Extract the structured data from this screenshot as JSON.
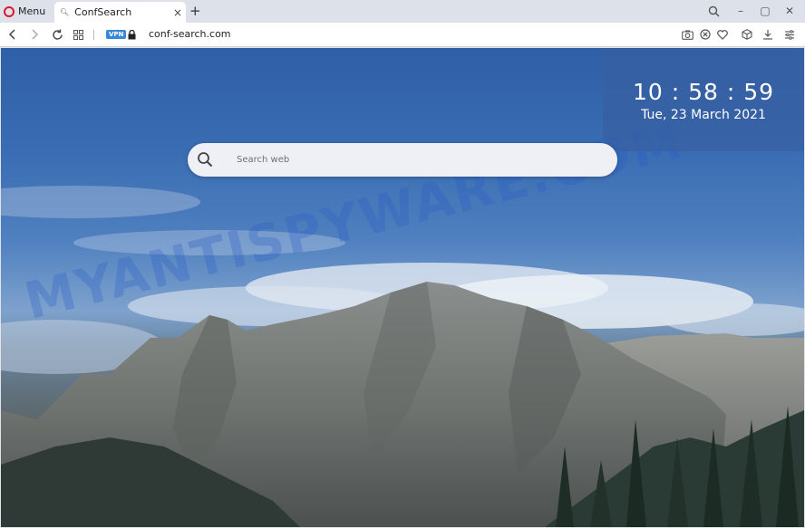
{
  "browser": {
    "menu_label": "Menu",
    "tab": {
      "title": "ConfSearch",
      "close": "×"
    },
    "new_tab": "+",
    "window_controls": {
      "search": "search-icon",
      "minimize": "–",
      "maximize": "▢",
      "close": "✕"
    },
    "address": {
      "vpn_badge": "VPN",
      "url": "conf-search.com"
    },
    "nav_icons": [
      "back-icon",
      "forward-icon",
      "reload-icon",
      "tabs-grid-icon"
    ],
    "toolbar_icons": [
      "camera-icon",
      "shield-icon",
      "heart-icon",
      "cube-icon",
      "download-icon",
      "easy-setup-icon"
    ]
  },
  "clock": {
    "time": "10 : 58 : 59",
    "date": "Tue, 23 March 2021"
  },
  "search": {
    "placeholder": "Search web"
  },
  "watermark": "MYANTISPYWARE.COM",
  "colors": {
    "sky": "#3a6db3",
    "clock_panel": "#375fa0",
    "search_bg": "#eef0f6",
    "opera_red": "#e0162b",
    "vpn_blue": "#3a87d8"
  }
}
